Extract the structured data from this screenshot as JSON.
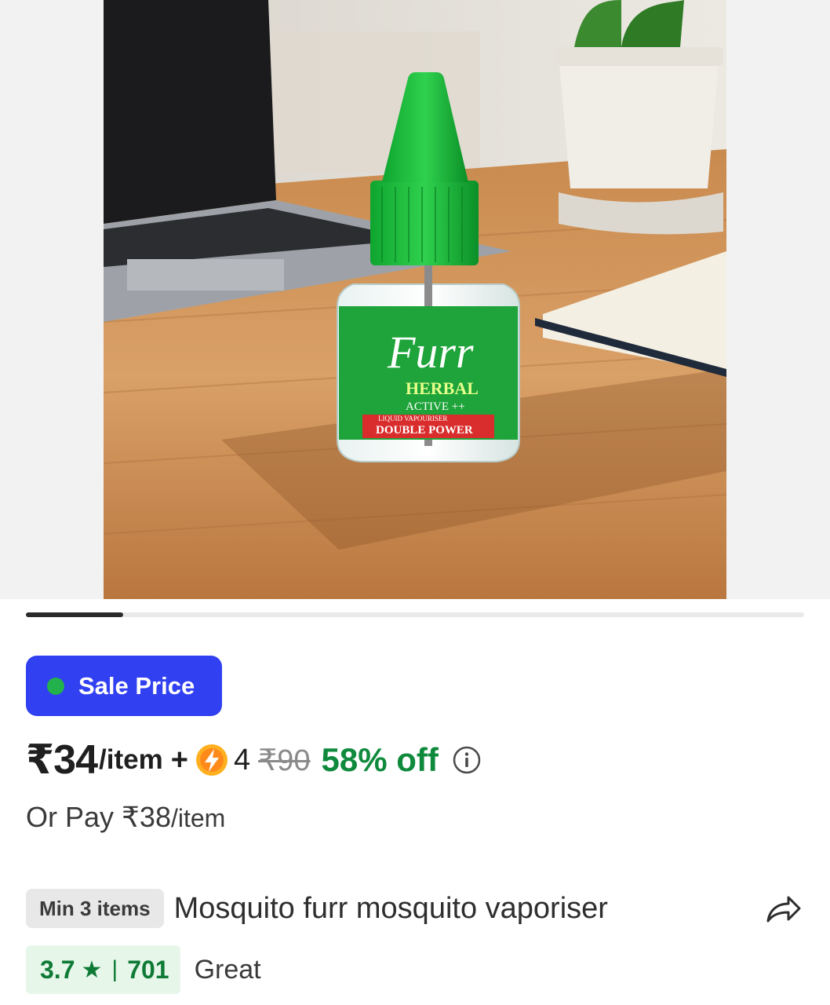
{
  "product_image": {
    "label_brand": "Furr",
    "label_line1": "HERBAL",
    "label_line2": "ACTIVE ++",
    "label_line3": "LIQUID VAPOURISER",
    "label_line4": "DOUBLE POWER"
  },
  "carousel": {
    "current_index": 1,
    "total": 8
  },
  "sale_badge": {
    "label": "Sale Price",
    "dot_color": "#22b14c",
    "bg_color": "#3140f1"
  },
  "price": {
    "current": "₹34",
    "unit": "/item",
    "plus": "+",
    "coin_icon": "lightning-coin-icon",
    "coins": "4",
    "mrp": "₹90",
    "discount": "58% off",
    "discount_color": "#0f8a3c",
    "info_icon": "info-icon"
  },
  "alt_price": {
    "prefix": "Or Pay ₹38",
    "unit": "/item"
  },
  "product": {
    "min_badge": "Min 3 items",
    "title": "Mosquito furr mosquito vaporiser",
    "share_icon": "share-icon"
  },
  "rating": {
    "score": "3.7",
    "star": "★",
    "separator": "|",
    "count": "701",
    "label": "Great",
    "color": "#0f7a35"
  }
}
